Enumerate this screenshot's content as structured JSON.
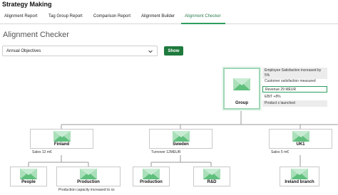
{
  "app": {
    "title": "Strategy Making"
  },
  "tabs": [
    {
      "label": "Alignment Report"
    },
    {
      "label": "Tag Group Report"
    },
    {
      "label": "Comparison Report"
    },
    {
      "label": "Alignment Builder"
    },
    {
      "label": "Alignment Checker",
      "active": true
    }
  ],
  "page": {
    "title": "Alignment Checker"
  },
  "filter": {
    "selected": "Annual Objectives",
    "show_label": "Show"
  },
  "root": {
    "name": "Group",
    "kpis": [
      {
        "text": "Employee Satisfaction increased by"
      },
      {
        "text": "5%"
      },
      {
        "text": "Customer satisfaction measured"
      },
      {
        "text": "Revenue 29 MEUR"
      },
      {
        "text": "EBIT +8%"
      },
      {
        "text": "Product x launched"
      }
    ]
  },
  "level1": [
    {
      "name": "Finland",
      "kpi": "Sales 12 m€"
    },
    {
      "name": "Sweden",
      "kpi": "Turnover 12MEUR"
    },
    {
      "name": "UK1",
      "kpi": "Sales 5 m€"
    }
  ],
  "level2": [
    {
      "name": "People"
    },
    {
      "name": "Production",
      "kpi": "Production capacity increased to xx"
    },
    {
      "name": "Production"
    },
    {
      "name": "R&D"
    },
    {
      "name": "Ireland branch"
    }
  ],
  "colors": {
    "accent": "#2e9e5e",
    "button": "#1f7a3d",
    "thumb_bg": "#a9dfb9",
    "thumb_fg": "#5fbf7d"
  }
}
